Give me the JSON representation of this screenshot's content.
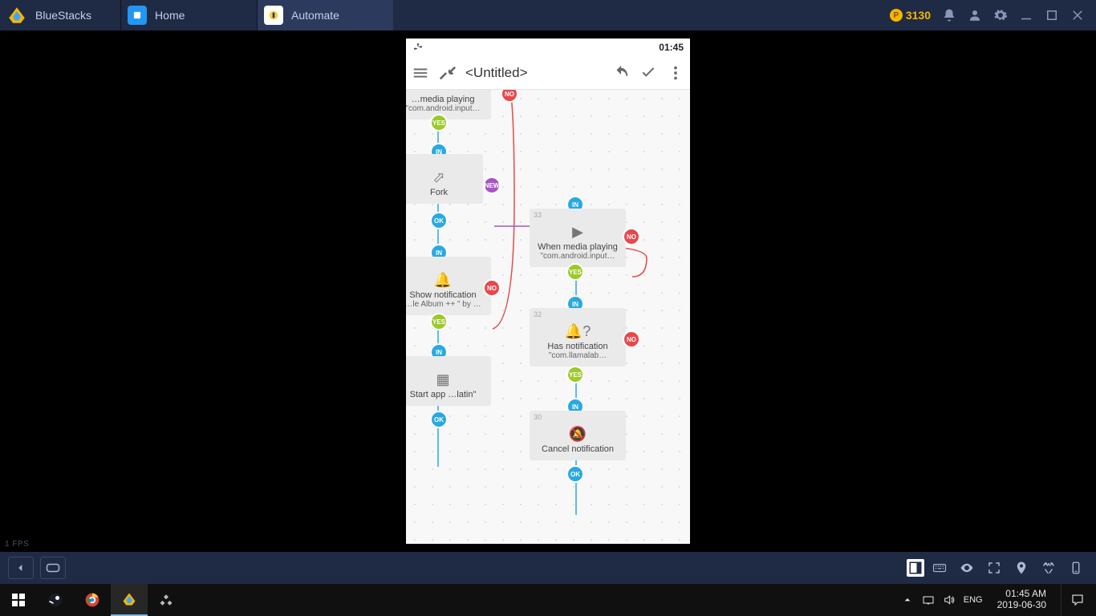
{
  "bluestacks": {
    "title": "BlueStacks",
    "coins": "3130",
    "tabs": [
      {
        "label": "Home"
      },
      {
        "label": "Automate"
      }
    ],
    "fps_overlay": "1 FPS"
  },
  "android": {
    "status_time": "01:45"
  },
  "automate": {
    "title": "<Untitled>",
    "ports": {
      "in": "IN",
      "ok": "OK",
      "yes": "YES",
      "no": "NO",
      "new": "NEW"
    },
    "blocks": {
      "top_partial": {
        "line1": "…media playing",
        "line2": "\"com.android.input…"
      },
      "fork": {
        "title": "Fork"
      },
      "show_notif": {
        "line1": "Show notification",
        "line2": "…le Album ++ \" by …"
      },
      "start_app": {
        "line1": "Start app …latin\""
      },
      "media_playing": {
        "num": "33",
        "line1": "When media playing",
        "line2": "\"com.android.input…"
      },
      "has_notif": {
        "num": "32",
        "line1": "Has notification",
        "line2": "\"com.llamalab…"
      },
      "cancel_notif": {
        "num": "30",
        "line1": "Cancel notification"
      }
    }
  },
  "windows": {
    "lang": "ENG",
    "time": "01:45 AM",
    "date": "2019-06-30"
  }
}
